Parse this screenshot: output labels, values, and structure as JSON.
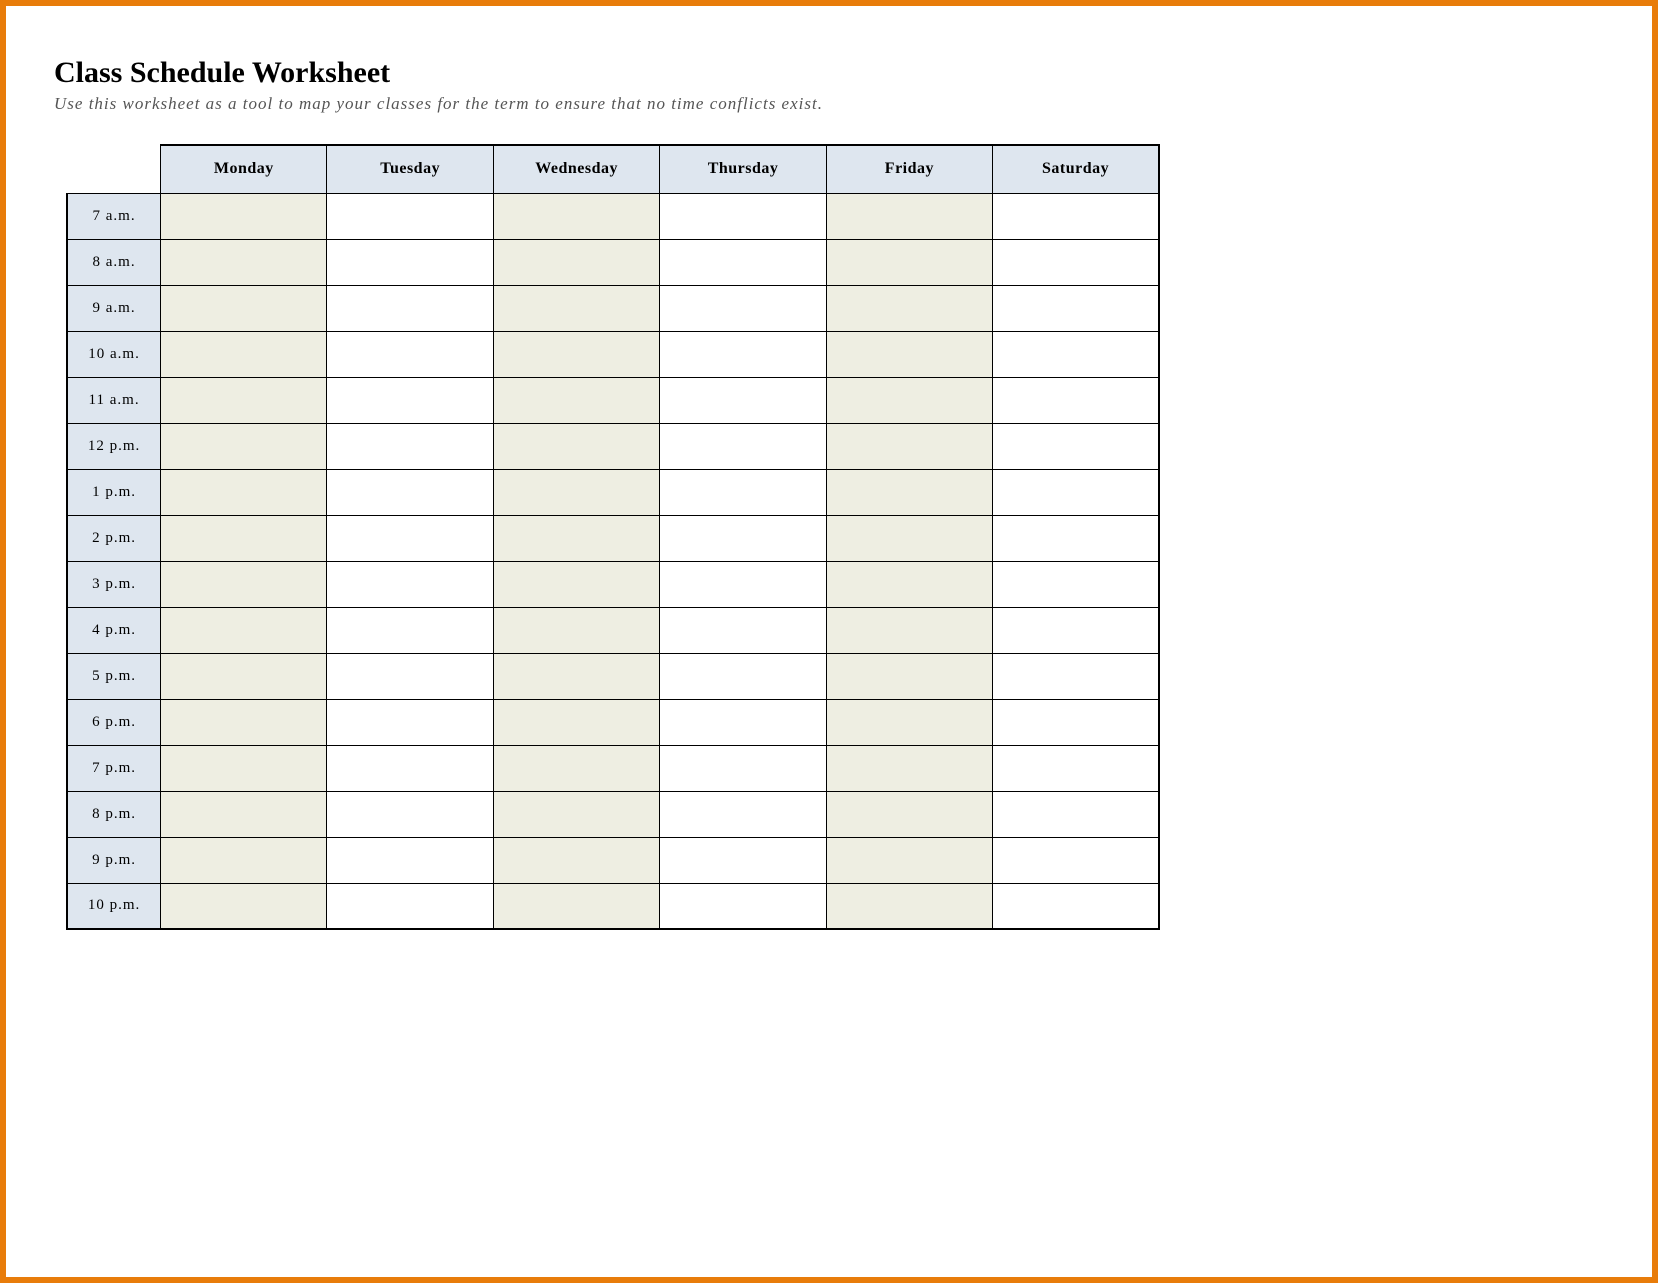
{
  "title": "Class Schedule Worksheet",
  "subtitle": "Use this worksheet as a tool to map your classes for the term to ensure that no time conflicts exist.",
  "days": [
    "Monday",
    "Tuesday",
    "Wednesday",
    "Thursday",
    "Friday",
    "Saturday"
  ],
  "times": [
    "7 a.m.",
    "8 a.m.",
    "9 a.m.",
    "10 a.m.",
    "11 a.m.",
    "12 p.m.",
    "1 p.m.",
    "2 p.m.",
    "3 p.m.",
    "4 p.m.",
    "5 p.m.",
    "6 p.m.",
    "7 p.m.",
    "8 p.m.",
    "9 p.m.",
    "10 p.m."
  ],
  "shaded_day_indices": [
    0,
    2,
    4
  ]
}
